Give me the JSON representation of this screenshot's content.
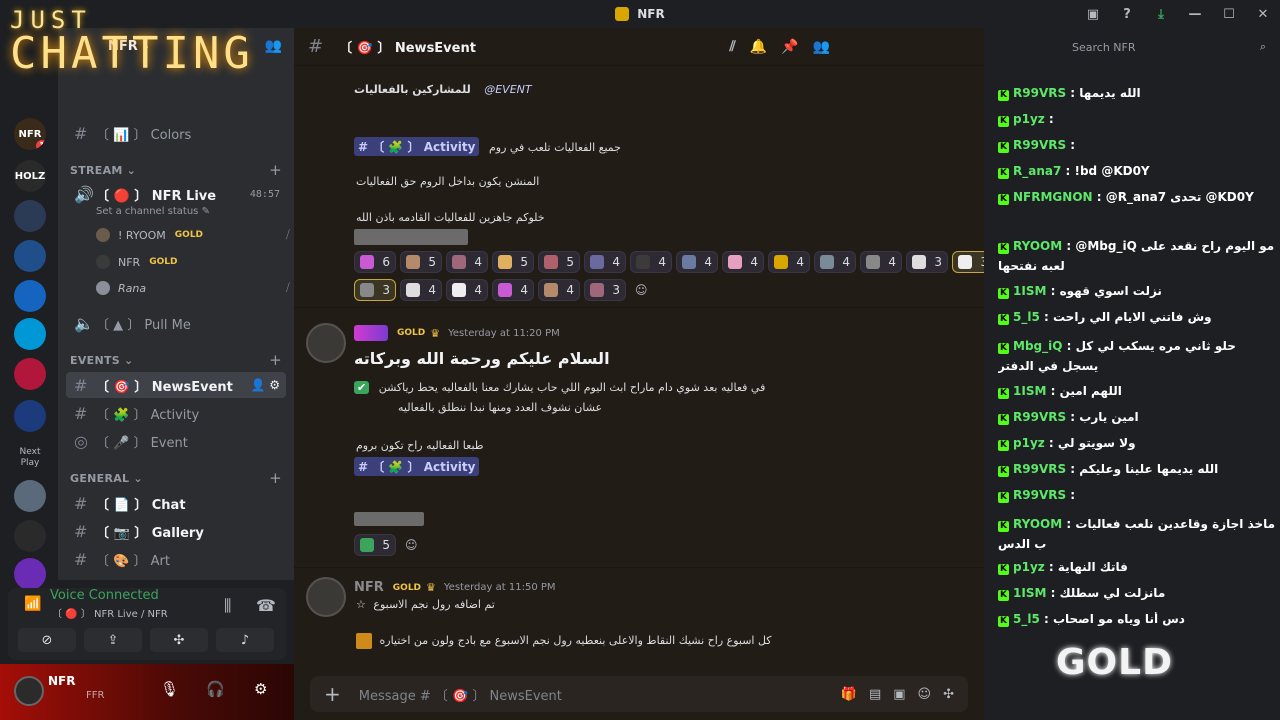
{
  "window": {
    "title": "NFR"
  },
  "overlay_banner": {
    "line1": "JUST",
    "line2": "CHATTING"
  },
  "server": {
    "name": "NFR"
  },
  "guilds": [
    {
      "label": "NFR",
      "badge": "1",
      "color": "#3a2a1a"
    },
    {
      "label": "HOLZ",
      "badge": "",
      "color": "#2a2a2a"
    },
    {
      "label": "",
      "badge": "",
      "color": "#2c3b55"
    },
    {
      "label": "",
      "badge": "",
      "color": "#1f4e8a"
    },
    {
      "label": "",
      "badge": "",
      "color": "#1565c0"
    },
    {
      "label": "",
      "badge": "",
      "color": "#0097d6"
    },
    {
      "label": "",
      "badge": "",
      "color": "#b0173a"
    },
    {
      "label": "",
      "badge": "",
      "color": "#1c3b7c"
    },
    {
      "label": "Next Play",
      "badge": "",
      "color": "#1e1f22"
    },
    {
      "label": "",
      "badge": "",
      "color": "#5a6a7a"
    },
    {
      "label": "",
      "badge": "",
      "color": "#2a2a2a"
    },
    {
      "label": "",
      "badge": "",
      "color": "#6a2bb5"
    }
  ],
  "sidebar": {
    "colors_channel": "〔 📊 〕 Colors",
    "stream_category": "STREAM",
    "nfr_live": "〔 🔴 〕 NFR Live",
    "nfr_live_time": "48:57",
    "channel_status": "Set a channel status",
    "voice_users": [
      {
        "name": "! RYOOM",
        "tag": "GOLD"
      },
      {
        "name": "NFR",
        "tag": "GOLD"
      },
      {
        "name": "Rana",
        "tag": ""
      }
    ],
    "pull_me": "〔 ▲ 〕 Pull Me",
    "events_category": "EVENTS",
    "news_event": "〔 🎯 〕 NewsEvent",
    "activity": "〔 🧩 〕 Activity",
    "event": "〔 🎤 〕 Event",
    "general_category": "GENERAL",
    "chat": "〔 📄 〕 Chat",
    "gallery": "〔 📷 〕 Gallery",
    "art": "〔 🎨 〕 Art"
  },
  "voice": {
    "status": "Voice Connected",
    "channel": "〔 🔴 〕 NFR Live / NFR"
  },
  "user": {
    "name": "NFR",
    "sub": "FFR"
  },
  "channel_header": {
    "name": "〔 🎯 〕 NewsEvent",
    "search_placeholder": "Search NFR"
  },
  "messages": {
    "m1": {
      "line1": "للمشاركين بالفعاليات",
      "mention": "@EVENT",
      "line2_pre": "جميع الفعاليات تلعب في روم",
      "activity_chip": "# 〔 🧩 〕 Activity",
      "line3": "المنشن يكون بداخل الروم حق الفعاليات",
      "line4": "خلوكم جاهزين للفعاليات القادمه باذن الله",
      "reactions_row1": [
        "6",
        "5",
        "4",
        "5",
        "5",
        "4",
        "4",
        "4",
        "4",
        "4",
        "4",
        "4",
        "3",
        "3"
      ],
      "reactions_row2": [
        "3",
        "4",
        "4",
        "4",
        "4",
        "3"
      ]
    },
    "m2": {
      "tag": "GOLD",
      "timestamp": "Yesterday at 11:20 PM",
      "title": "السلام عليكم ورحمة الله وبركاته",
      "line1": "في فعاليه بعد شوي دام ماراح ابث اليوم اللي حاب يشارك معنا بالفعاليه يحط رياكشن",
      "line2": "عشان نشوف العدد ومنها نبدا ننطلق بالفعاليه",
      "line3": "طبعا الفعاليه راح تكون بروم",
      "activity_chip": "# 〔 🧩 〕 Activity",
      "check_count": "5"
    },
    "m3": {
      "author": "NFR",
      "tag": "GOLD",
      "timestamp": "Yesterday at 11:50 PM",
      "line1": "تم اضافه رول نجم الاسبوع",
      "line2": "كل اسبوع راح نشيك النقاط والاعلى بنعطيه رول نجم الاسبوع مع بادج ولون من اختياره"
    }
  },
  "composer": {
    "placeholder": "Message # 〔 🎯 〕 NewsEvent"
  },
  "stream_chat": [
    {
      "user": "R99VRS",
      "text": "الله يديمها"
    },
    {
      "user": "p1yz",
      "text": ""
    },
    {
      "user": "R99VRS",
      "text": ""
    },
    {
      "user": "R_ana7",
      "text": "!bd @KD0Y"
    },
    {
      "user": "NFRMGNON",
      "text": "@R_ana7 تحدى @KD0Y"
    },
    {
      "user": "RYOOM",
      "text": "@Mbg_iQ مو اليوم راح نقعد على لعبه نفتحها"
    },
    {
      "user": "1ISM",
      "text": "نزلت اسوي قهوه"
    },
    {
      "user": "5_l5",
      "text": "وش فاتني الايام الي راحت"
    },
    {
      "user": "Mbg_iQ",
      "text": "حلو ثاني مره يسكب لي كل يسجل في الدفتر"
    },
    {
      "user": "1ISM",
      "text": "اللهم امين"
    },
    {
      "user": "R99VRS",
      "text": "امين يارب"
    },
    {
      "user": "p1yz",
      "text": "ولا سويتو لي"
    },
    {
      "user": "R99VRS",
      "text": "الله يديمها علينا وعليكم"
    },
    {
      "user": "R99VRS",
      "text": ""
    },
    {
      "user": "RYOOM",
      "text": "ماخذ اجازة وقاعدين نلعب فعاليات ب الدس"
    },
    {
      "user": "p1yz",
      "text": "فاتك النهاية"
    },
    {
      "user": "1ISM",
      "text": "مانزلت لي سطلك"
    },
    {
      "user": "5_l5",
      "text": "دس أنا وياه مو اصحاب"
    }
  ],
  "overlay_logo": "GOLD",
  "colors": {
    "accent": "#5865f2",
    "voice_green": "#3ba55c",
    "gold": "#f0c545",
    "kick_green": "#53fc18"
  }
}
